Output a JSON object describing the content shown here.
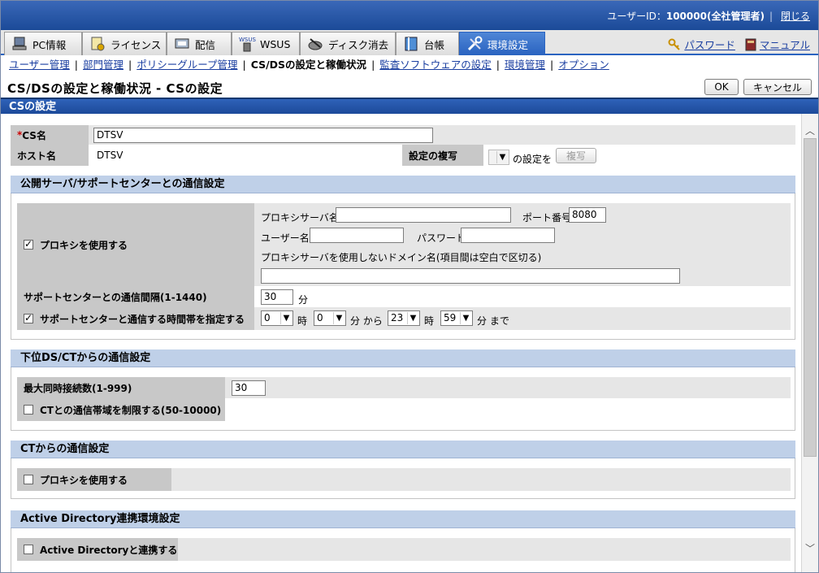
{
  "header": {
    "user_label": "ユーザーID：",
    "user_value": "100000(全社管理者)",
    "separator": "|",
    "close_link": "閉じる"
  },
  "tabs": [
    {
      "label": "PC情報",
      "icon": "pc-info-icon"
    },
    {
      "label": "ライセンス",
      "icon": "license-icon"
    },
    {
      "label": "配信",
      "icon": "distribution-icon"
    },
    {
      "label": "WSUS",
      "icon": "wsus-icon"
    },
    {
      "label": "ディスク消去",
      "icon": "disk-erase-icon"
    },
    {
      "label": "台帳",
      "icon": "ledger-icon"
    },
    {
      "label": "環境設定",
      "icon": "settings-tools-icon"
    }
  ],
  "right_links": {
    "password": "パスワード",
    "manual": "マニュアル"
  },
  "subnav": {
    "items": [
      "ユーザー管理",
      "部門管理",
      "ポリシーグループ管理",
      "CS/DSの設定と稼働状況",
      "監査ソフトウェアの設定",
      "環境管理",
      "オプション"
    ],
    "current_index": 3,
    "separator": "|"
  },
  "page": {
    "title": "CS/DSの設定と稼働状況 - CSの設定",
    "ok": "OK",
    "cancel": "キャンセル",
    "section": "CSの設定"
  },
  "cs": {
    "required_mark": "*",
    "cs_name_label": "CS名",
    "cs_name_value": "DTSV",
    "host_label": "ホスト名",
    "host_value": "DTSV",
    "copy_label": "設定の複写",
    "copy_suffix": "の設定を",
    "copy_button": "複写"
  },
  "public_group": {
    "title": "公開サーバ/サポートセンターとの通信設定",
    "use_proxy": "プロキシを使用する",
    "use_proxy_checked": true,
    "proxy_server_label": "プロキシサーバ名",
    "proxy_server_value": "",
    "port_label": "ポート番号",
    "port_value": "8080",
    "user_label": "ユーザー名",
    "user_value": "",
    "password_label": "パスワード",
    "password_value": "",
    "no_proxy_label": "プロキシサーバを使用しないドメイン名(項目間は空白で区切る)",
    "no_proxy_value": "",
    "interval_label": "サポートセンターとの通信間隔(1-1440)",
    "interval_value": "30",
    "interval_unit": "分",
    "timeband_label": "サポートセンターと通信する時間帯を指定する",
    "timeband_checked": true,
    "from_hour": "0",
    "hour_unit": "時",
    "from_min": "0",
    "min_from": "分 から",
    "to_hour": "23",
    "hour_unit2": "時",
    "to_min": "59",
    "min_to": "分 まで"
  },
  "lower_group": {
    "title": "下位DS/CTからの通信設定",
    "max_conn_label": "最大同時接続数(1-999)",
    "max_conn_value": "30",
    "limit_label": "CTとの通信帯域を制限する(50-10000)",
    "limit_checked": false
  },
  "ct_group": {
    "title": "CTからの通信設定",
    "use_proxy": "プロキシを使用する",
    "use_proxy_checked": false
  },
  "ad_group": {
    "title": "Active Directory連携環境設定",
    "link_label": "Active Directoryと連携する",
    "link_checked": false
  }
}
